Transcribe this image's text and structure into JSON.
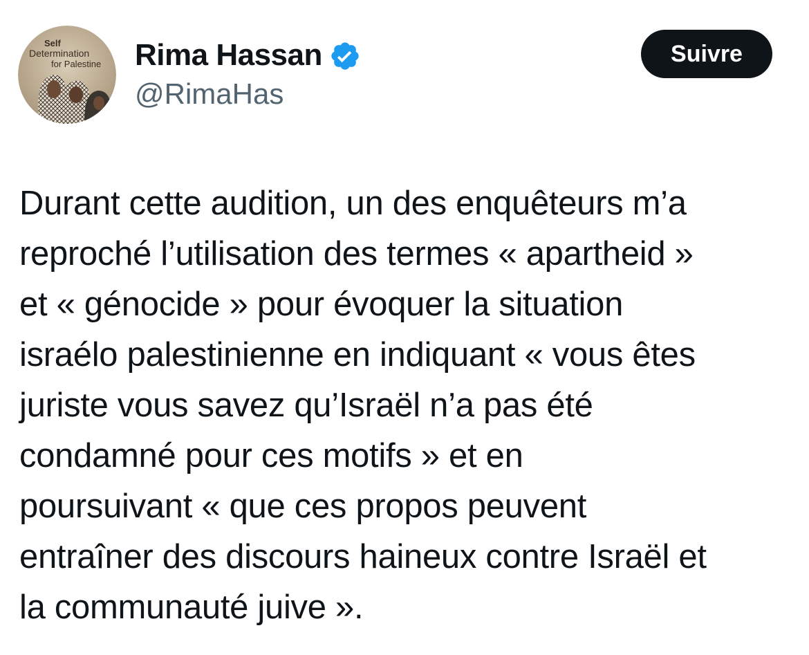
{
  "tweet": {
    "author": {
      "display_name": "Rima Hassan",
      "handle": "@RimaHas",
      "verified": true,
      "verified_color": "#1d9bf0",
      "avatar": {
        "icon": "avatar-badge-image",
        "text_line_1": "Self",
        "text_line_2": "Determination",
        "text_line_3": "for Palestine"
      }
    },
    "follow_label": "Suivre",
    "text_lines": [
      "Durant cette audition, un des enquêteurs m’a",
      "reproché l’utilisation des termes « apartheid »",
      "et « génocide » pour évoquer la situation",
      "israélo palestinienne en indiquant « vous êtes",
      "juriste vous savez qu’Israël n’a pas été",
      "condamné pour ces motifs » et en",
      "poursuivant « que ces propos peuvent",
      "entraîner des discours haineux contre Israël et",
      "la communauté juive »."
    ]
  }
}
